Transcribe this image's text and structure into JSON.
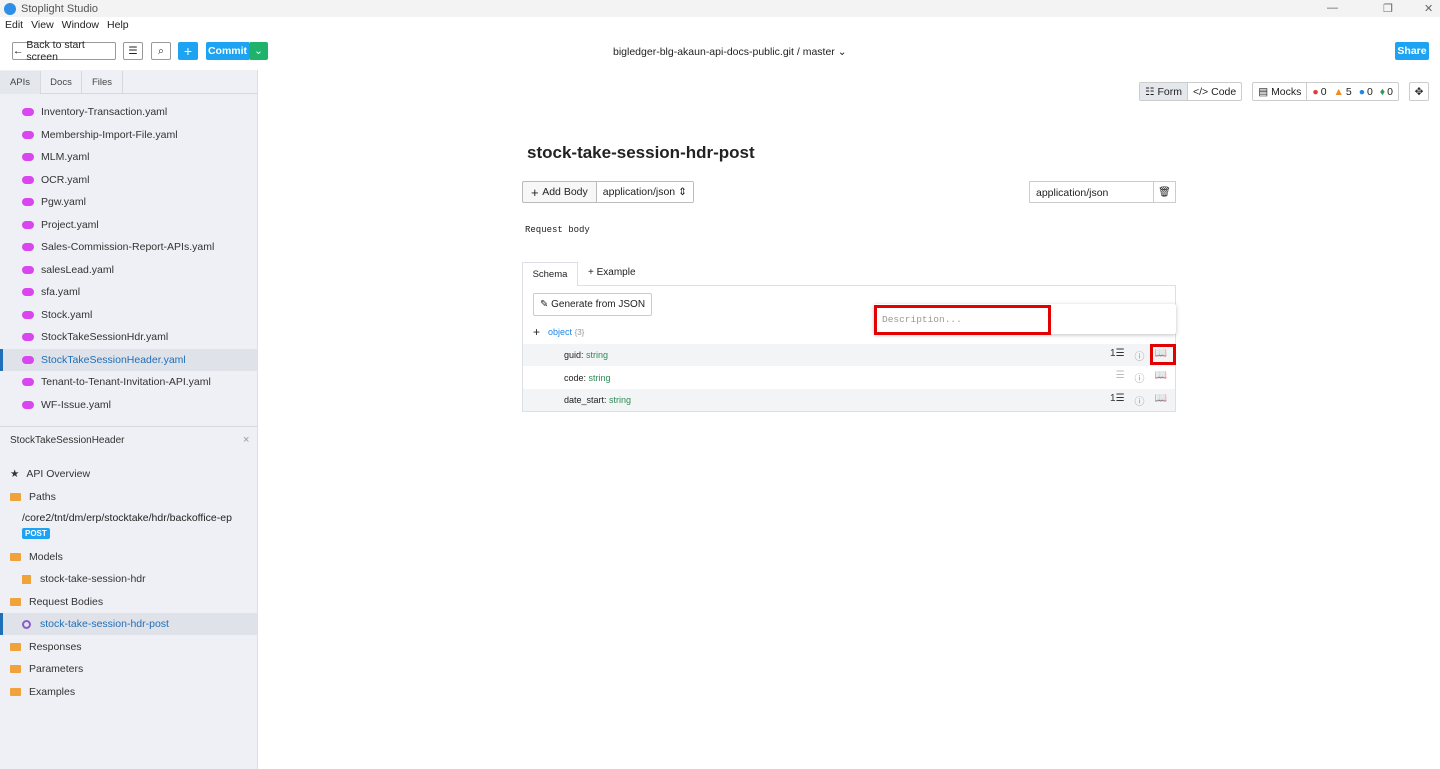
{
  "app": {
    "title": "Stoplight Studio",
    "menu": [
      "Edit",
      "View",
      "Window",
      "Help"
    ]
  },
  "toolbar": {
    "back": "Back to start screen",
    "commit": "Commit",
    "repo": "bigledger-blg-akaun-api-docs-public.git",
    "separator": "/",
    "branch": "master",
    "share": "Share"
  },
  "sidebar": {
    "tabs": [
      "APIs",
      "Docs",
      "Files"
    ],
    "files": [
      "Inventory-Transaction.yaml",
      "Membership-Import-File.yaml",
      "MLM.yaml",
      "OCR.yaml",
      "Pgw.yaml",
      "Project.yaml",
      "Sales-Commission-Report-APIs.yaml",
      "salesLead.yaml",
      "sfa.yaml",
      "Stock.yaml",
      "StockTakeSessionHdr.yaml",
      "StockTakeSessionHeader.yaml",
      "Tenant-to-Tenant-Invitation-API.yaml",
      "WF-Issue.yaml"
    ],
    "selected_file": "StockTakeSessionHeader.yaml",
    "panel_title": "StockTakeSessionHeader",
    "tree": {
      "overview": "API Overview",
      "paths": "Paths",
      "path": "/core2/tnt/dm/erp/stocktake/hdr/backoffice-ep",
      "method": "POST",
      "models": "Models",
      "model": "stock-take-session-hdr",
      "request_bodies": "Request Bodies",
      "request_body": "stock-take-session-hdr-post",
      "responses": "Responses",
      "parameters": "Parameters",
      "examples": "Examples"
    }
  },
  "viewbar": {
    "form": "Form",
    "code": "Code",
    "mocks": "Mocks",
    "errors": "0",
    "warnings": "5",
    "info": "0",
    "hints": "0"
  },
  "main": {
    "title": "stock-take-session-hdr-post",
    "add_body": "Add Body",
    "content_type": "application/json",
    "media_type_input": "application/json",
    "description": "Request body",
    "tabs": {
      "schema": "Schema",
      "example": "Example"
    },
    "generate": "Generate from JSON",
    "root": {
      "type": "object",
      "count": "{3}"
    },
    "properties": [
      {
        "name": "guid",
        "type": "string",
        "count": "1"
      },
      {
        "name": "code",
        "type": "string",
        "count": ""
      },
      {
        "name": "date_start",
        "type": "string",
        "count": "1"
      }
    ],
    "popover_placeholder": "Description..."
  }
}
